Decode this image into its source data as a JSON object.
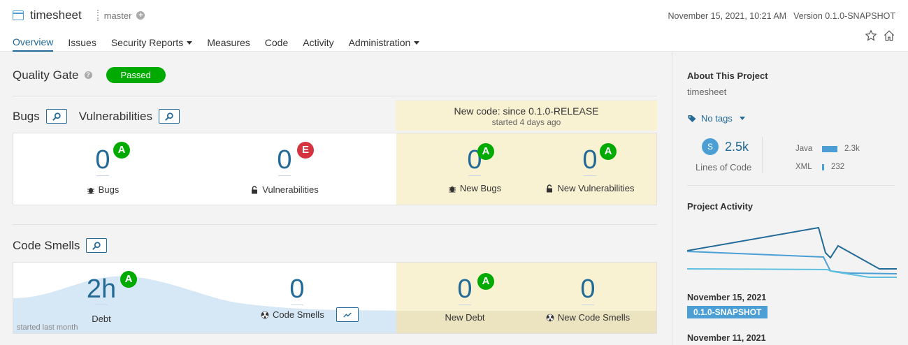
{
  "project": {
    "name": "timesheet",
    "branch": "master"
  },
  "meta": {
    "date": "November 15, 2021, 10:21 AM",
    "version": "Version 0.1.0-SNAPSHOT"
  },
  "nav": [
    {
      "label": "Overview",
      "active": true,
      "dropdown": false
    },
    {
      "label": "Issues",
      "active": false,
      "dropdown": false
    },
    {
      "label": "Security Reports",
      "active": false,
      "dropdown": true
    },
    {
      "label": "Measures",
      "active": false,
      "dropdown": false
    },
    {
      "label": "Code",
      "active": false,
      "dropdown": false
    },
    {
      "label": "Activity",
      "active": false,
      "dropdown": false
    },
    {
      "label": "Administration",
      "active": false,
      "dropdown": true
    }
  ],
  "quality_gate": {
    "title": "Quality Gate",
    "status": "Passed"
  },
  "sections": {
    "bugs": "Bugs",
    "vulnerabilities": "Vulnerabilities",
    "code_smells": "Code Smells"
  },
  "new_code": {
    "title": "New code: since 0.1.0-RELEASE",
    "subtitle": "started 4 days ago"
  },
  "reliability": {
    "bugs": {
      "value": "0",
      "rating": "A",
      "label": "Bugs"
    },
    "vulnerabilities": {
      "value": "0",
      "rating": "E",
      "label": "Vulnerabilities"
    },
    "new_bugs": {
      "value": "0",
      "rating": "A",
      "label": "New Bugs"
    },
    "new_vulnerabilities": {
      "value": "0",
      "rating": "A",
      "label": "New Vulnerabilities"
    }
  },
  "maintainability": {
    "debt": {
      "value": "2h",
      "rating": "A",
      "label": "Debt"
    },
    "code_smells": {
      "value": "0",
      "label": "Code Smells"
    },
    "new_debt": {
      "value": "0",
      "rating": "A",
      "label": "New Debt"
    },
    "new_code_smells": {
      "value": "0",
      "label": "New Code Smells"
    },
    "started": "started last month"
  },
  "sidebar": {
    "about_title": "About This Project",
    "project_name": "timesheet",
    "tags": "No tags",
    "loc_size": "S",
    "loc_value": "2.5k",
    "loc_label": "Lines of Code",
    "languages": [
      {
        "name": "Java",
        "value": "2.3k",
        "fraction": 1.0
      },
      {
        "name": "XML",
        "value": "232",
        "fraction": 0.1
      }
    ],
    "activity_title": "Project Activity",
    "events": [
      {
        "date": "November 15, 2021",
        "badge": "0.1.0-SNAPSHOT"
      },
      {
        "date": "November 11, 2021"
      }
    ]
  },
  "colors": {
    "accent": "#236a97",
    "passed": "#00aa00",
    "rating_a": "#00aa00",
    "rating_e": "#d4333f",
    "new_code_bg": "#f9f2d2"
  }
}
